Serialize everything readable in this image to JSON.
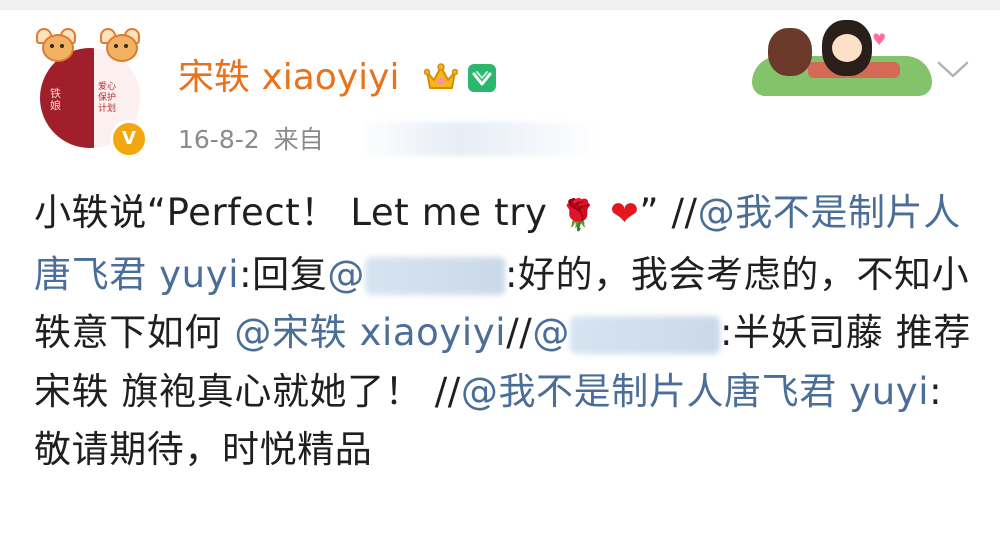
{
  "header": {
    "username": "宋轶 xiaoyiyi",
    "date": "16-8-2",
    "source_prefix": "来自",
    "avatar_side_text": "铁\n娘",
    "avatar_side_text2": "爱心\n保护\n计划"
  },
  "icons": {
    "crown": "crown-icon",
    "vip": "member-badge-icon",
    "verify": "verified-v-icon",
    "expand": "chevron-down-icon",
    "rose": "rose-emoji",
    "heart": "heart-emoji"
  },
  "colors": {
    "username": "#e9721b",
    "mention": "#4a6e98",
    "meta": "#8b8b8b"
  },
  "post": {
    "p1": "小轶说“Perfect！ Let me try ",
    "p2": "” //",
    "m1": "@我不是制片人唐飞君 yuyi",
    "p3": ":回复",
    "m2": "@",
    "p4": ":好的，我会考虑的，不知小轶意下如何 ",
    "m3": "@宋轶 xiaoyiyi",
    "p5": "//",
    "m4": "@",
    "p6": ":半妖司藤 推荐宋轶 旗袍真心就她了！ //",
    "m5": "@我不是制片人唐飞君 yuyi",
    "p7": ":敬请期待，时悦精品",
    "rose": "🌹",
    "heart": "❤"
  }
}
